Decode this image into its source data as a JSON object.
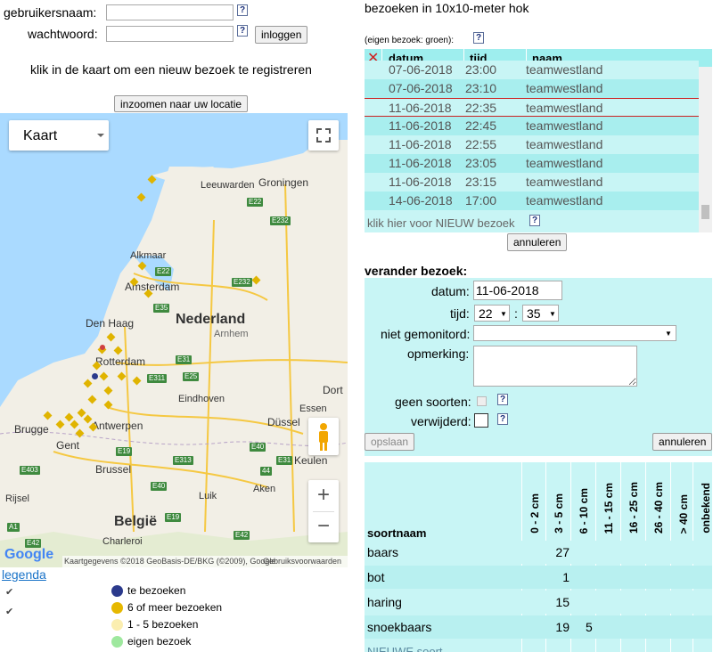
{
  "login": {
    "username_label": "gebruikersnaam:",
    "password_label": "wachtwoord:",
    "login_button": "inloggen",
    "help": "?"
  },
  "instruction": "klik in de kaart om een nieuw bezoek te registreren",
  "zoom_button": "inzoomen naar uw locatie",
  "map": {
    "type_selector": "Kaart",
    "labels": {
      "country_nl": "Nederland",
      "country_be": "België",
      "leeuwarden": "Leeuwarden",
      "groningen": "Groningen",
      "alkmaar": "Alkmaar",
      "amsterdam": "Amsterdam",
      "den_haag": "Den Haag",
      "rotterdam": "Rotterdam",
      "arnhem": "Arnhem",
      "eindhoven": "Eindhoven",
      "antwerpen": "Antwerpen",
      "brugge": "Brugge",
      "gent": "Gent",
      "brussel": "Brussel",
      "luik": "Luik",
      "aken": "Aken",
      "charleroi": "Charleroi",
      "dussel": "Düssel",
      "essen": "Essen",
      "keulen": "Keulen",
      "dort": "Dort",
      "rijsel": "Rijsel"
    },
    "roads": [
      "E22",
      "E232",
      "E22",
      "E35",
      "E232",
      "E31",
      "E311",
      "E25",
      "E19",
      "E313",
      "E40",
      "E19",
      "E42",
      "E403",
      "E42",
      "A1",
      "E40",
      "44",
      "E31"
    ],
    "attribution": "Kaartgegevens ©2018 GeoBasis-DE/BKG (©2009), Google",
    "terms": "Gebruiksvoorwaarden",
    "google": "Google",
    "zoom_in": "+",
    "zoom_out": "−"
  },
  "legend": {
    "link": "legenda",
    "items": [
      {
        "label": "te bezoeken",
        "color": "#2b3a8c"
      },
      {
        "label": "6 of meer bezoeken",
        "color": "#e6b800"
      },
      {
        "label": "1 - 5 bezoeken",
        "color": "#fbeeb0"
      },
      {
        "label": "eigen bezoek",
        "color": "#9ee89e"
      }
    ]
  },
  "visits": {
    "title": "bezoeken in 10x10-meter hok",
    "own_note": "(eigen bezoek: groen):",
    "col_date": "datum",
    "col_time": "tijd",
    "col_name": "naam",
    "rows": [
      {
        "date": "07-06-2018",
        "time": "23:00",
        "name": "teamwestland"
      },
      {
        "date": "07-06-2018",
        "time": "23:10",
        "name": "teamwestland"
      },
      {
        "date": "11-06-2018",
        "time": "22:35",
        "name": "teamwestland"
      },
      {
        "date": "11-06-2018",
        "time": "22:45",
        "name": "teamwestland"
      },
      {
        "date": "11-06-2018",
        "time": "22:55",
        "name": "teamwestland"
      },
      {
        "date": "11-06-2018",
        "time": "23:05",
        "name": "teamwestland"
      },
      {
        "date": "11-06-2018",
        "time": "23:15",
        "name": "teamwestland"
      },
      {
        "date": "14-06-2018",
        "time": "17:00",
        "name": "teamwestland"
      }
    ],
    "new_visit_link": "klik hier voor NIEUW bezoek",
    "cancel": "annuleren"
  },
  "edit": {
    "title": "verander bezoek:",
    "date_label": "datum:",
    "date_value": "11-06-2018",
    "time_label": "tijd:",
    "hour": "22",
    "minute": "35",
    "time_sep": ":",
    "not_monitored_label": "niet gemonitord:",
    "remark_label": "opmerking:",
    "no_species_label": "geen soorten:",
    "deleted_label": "verwijderd:",
    "save": "opslaan",
    "cancel": "annuleren"
  },
  "species": {
    "col_name": "soortnaam",
    "sizes": [
      "0 - 2 cm",
      "3 - 5 cm",
      "6 - 10 cm",
      "11 - 15 cm",
      "16 - 25 cm",
      "26 - 40 cm",
      "> 40 cm",
      "onbekend"
    ],
    "rows": [
      {
        "name": "baars",
        "c1": "27",
        "c2": ""
      },
      {
        "name": "bot",
        "c1": "1",
        "c2": ""
      },
      {
        "name": "haring",
        "c1": "15",
        "c2": ""
      },
      {
        "name": "snoekbaars",
        "c1": "19",
        "c2": "5"
      }
    ],
    "new_species": "NIEUWE soort"
  }
}
